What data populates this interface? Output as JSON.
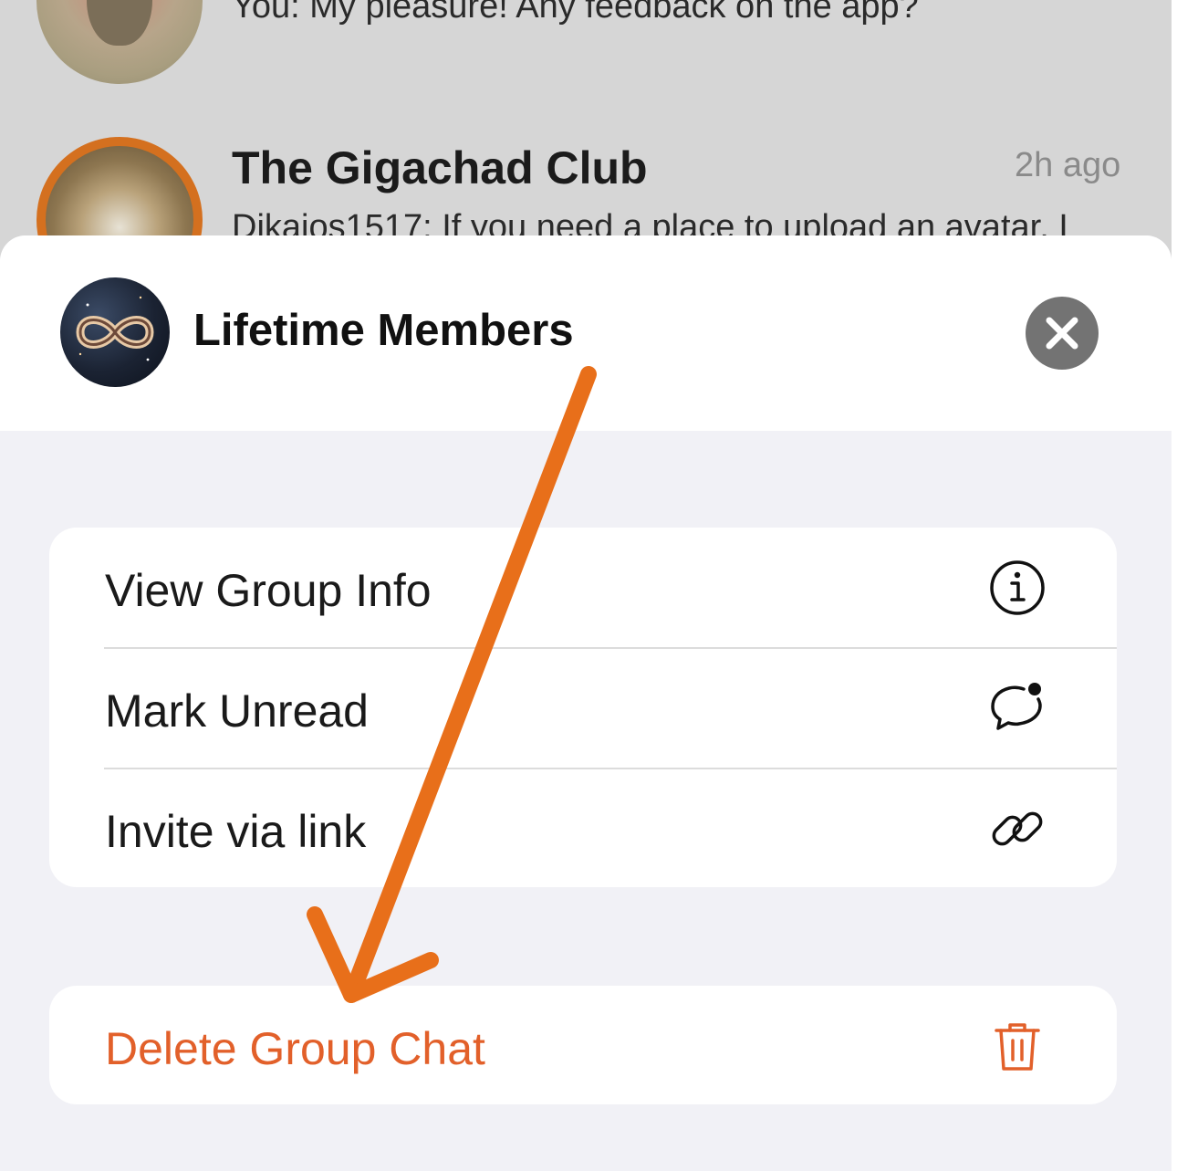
{
  "chat_list": {
    "previous_message": "You: My pleasure! Any feedback on the app?",
    "item": {
      "title": "The Gigachad Club",
      "time": "2h ago",
      "preview": "Dikaios1517: If you need a place to upload an avatar, I"
    }
  },
  "sheet": {
    "group_name": "Lifetime Members",
    "actions": [
      {
        "label": "View Group Info",
        "icon": "info-circle-icon"
      },
      {
        "label": "Mark Unread",
        "icon": "chat-bubble-unread-icon"
      },
      {
        "label": "Invite via link",
        "icon": "link-icon"
      }
    ],
    "danger_action": {
      "label": "Delete Group Chat",
      "icon": "trash-icon"
    }
  },
  "colors": {
    "danger": "#e2602a",
    "annotation_arrow": "#e86f1a",
    "sheet_background": "#f1f1f6",
    "close_button": "#737373"
  }
}
